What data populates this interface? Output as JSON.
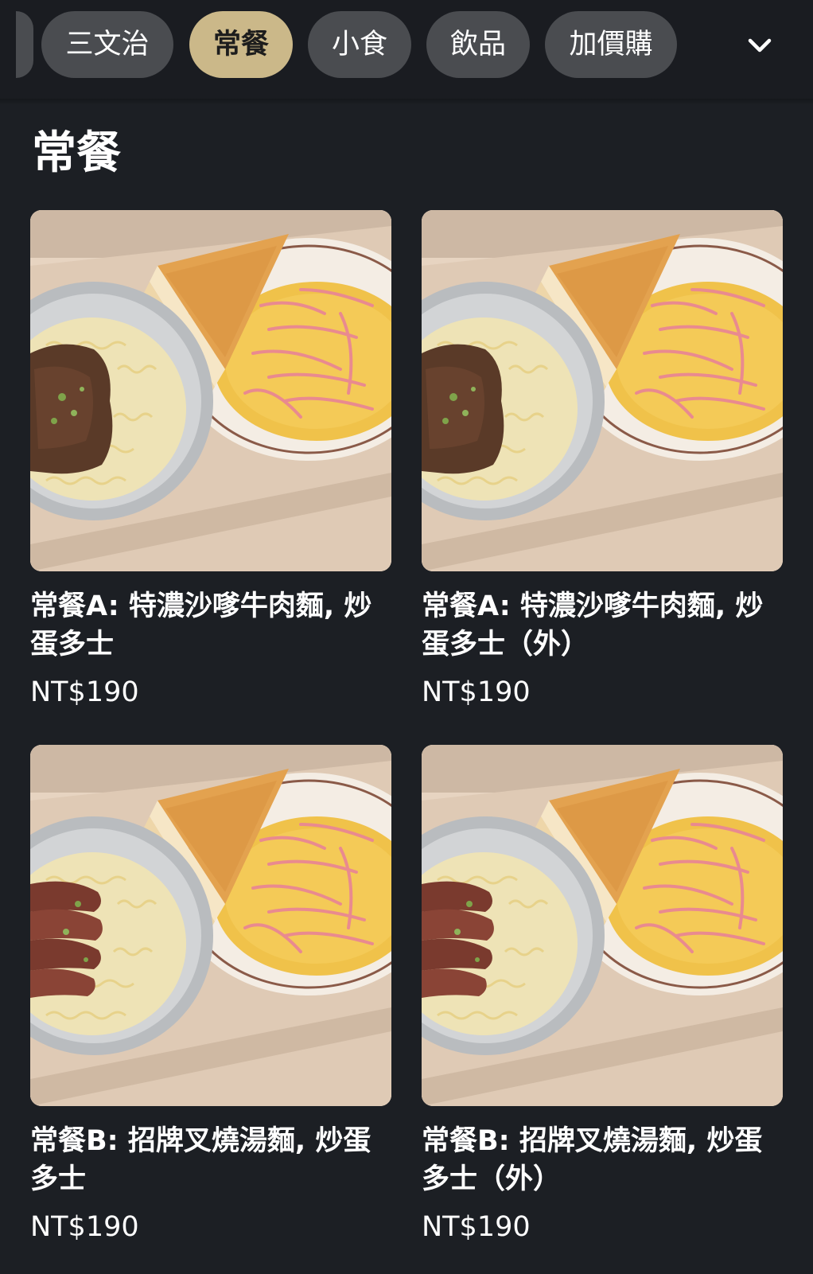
{
  "categories": {
    "items": [
      {
        "label": "三文治",
        "active": false
      },
      {
        "label": "常餐",
        "active": true
      },
      {
        "label": "小食",
        "active": false
      },
      {
        "label": "飲品",
        "active": false
      },
      {
        "label": "加價購",
        "active": false
      }
    ],
    "expand_icon": "chevron-down-icon"
  },
  "section": {
    "title": "常餐"
  },
  "products": [
    {
      "name": "常餐A: 特濃沙嗲牛肉麵, 炒蛋多士",
      "price": "NT$190",
      "photo": "beef-noodle-set"
    },
    {
      "name": "常餐A: 特濃沙嗲牛肉麵, 炒蛋多士（外）",
      "price": "NT$190",
      "photo": "beef-noodle-set"
    },
    {
      "name": "常餐B: 招牌叉燒湯麵, 炒蛋多士",
      "price": "NT$190",
      "photo": "char-siu-noodle-set"
    },
    {
      "name": "常餐B: 招牌叉燒湯麵, 炒蛋多士（外）",
      "price": "NT$190",
      "photo": "char-siu-noodle-set"
    }
  ],
  "colors": {
    "background": "#1c1f24",
    "chip": "#4a4c50",
    "chip_active": "#cbb889",
    "text": "#ffffff"
  }
}
